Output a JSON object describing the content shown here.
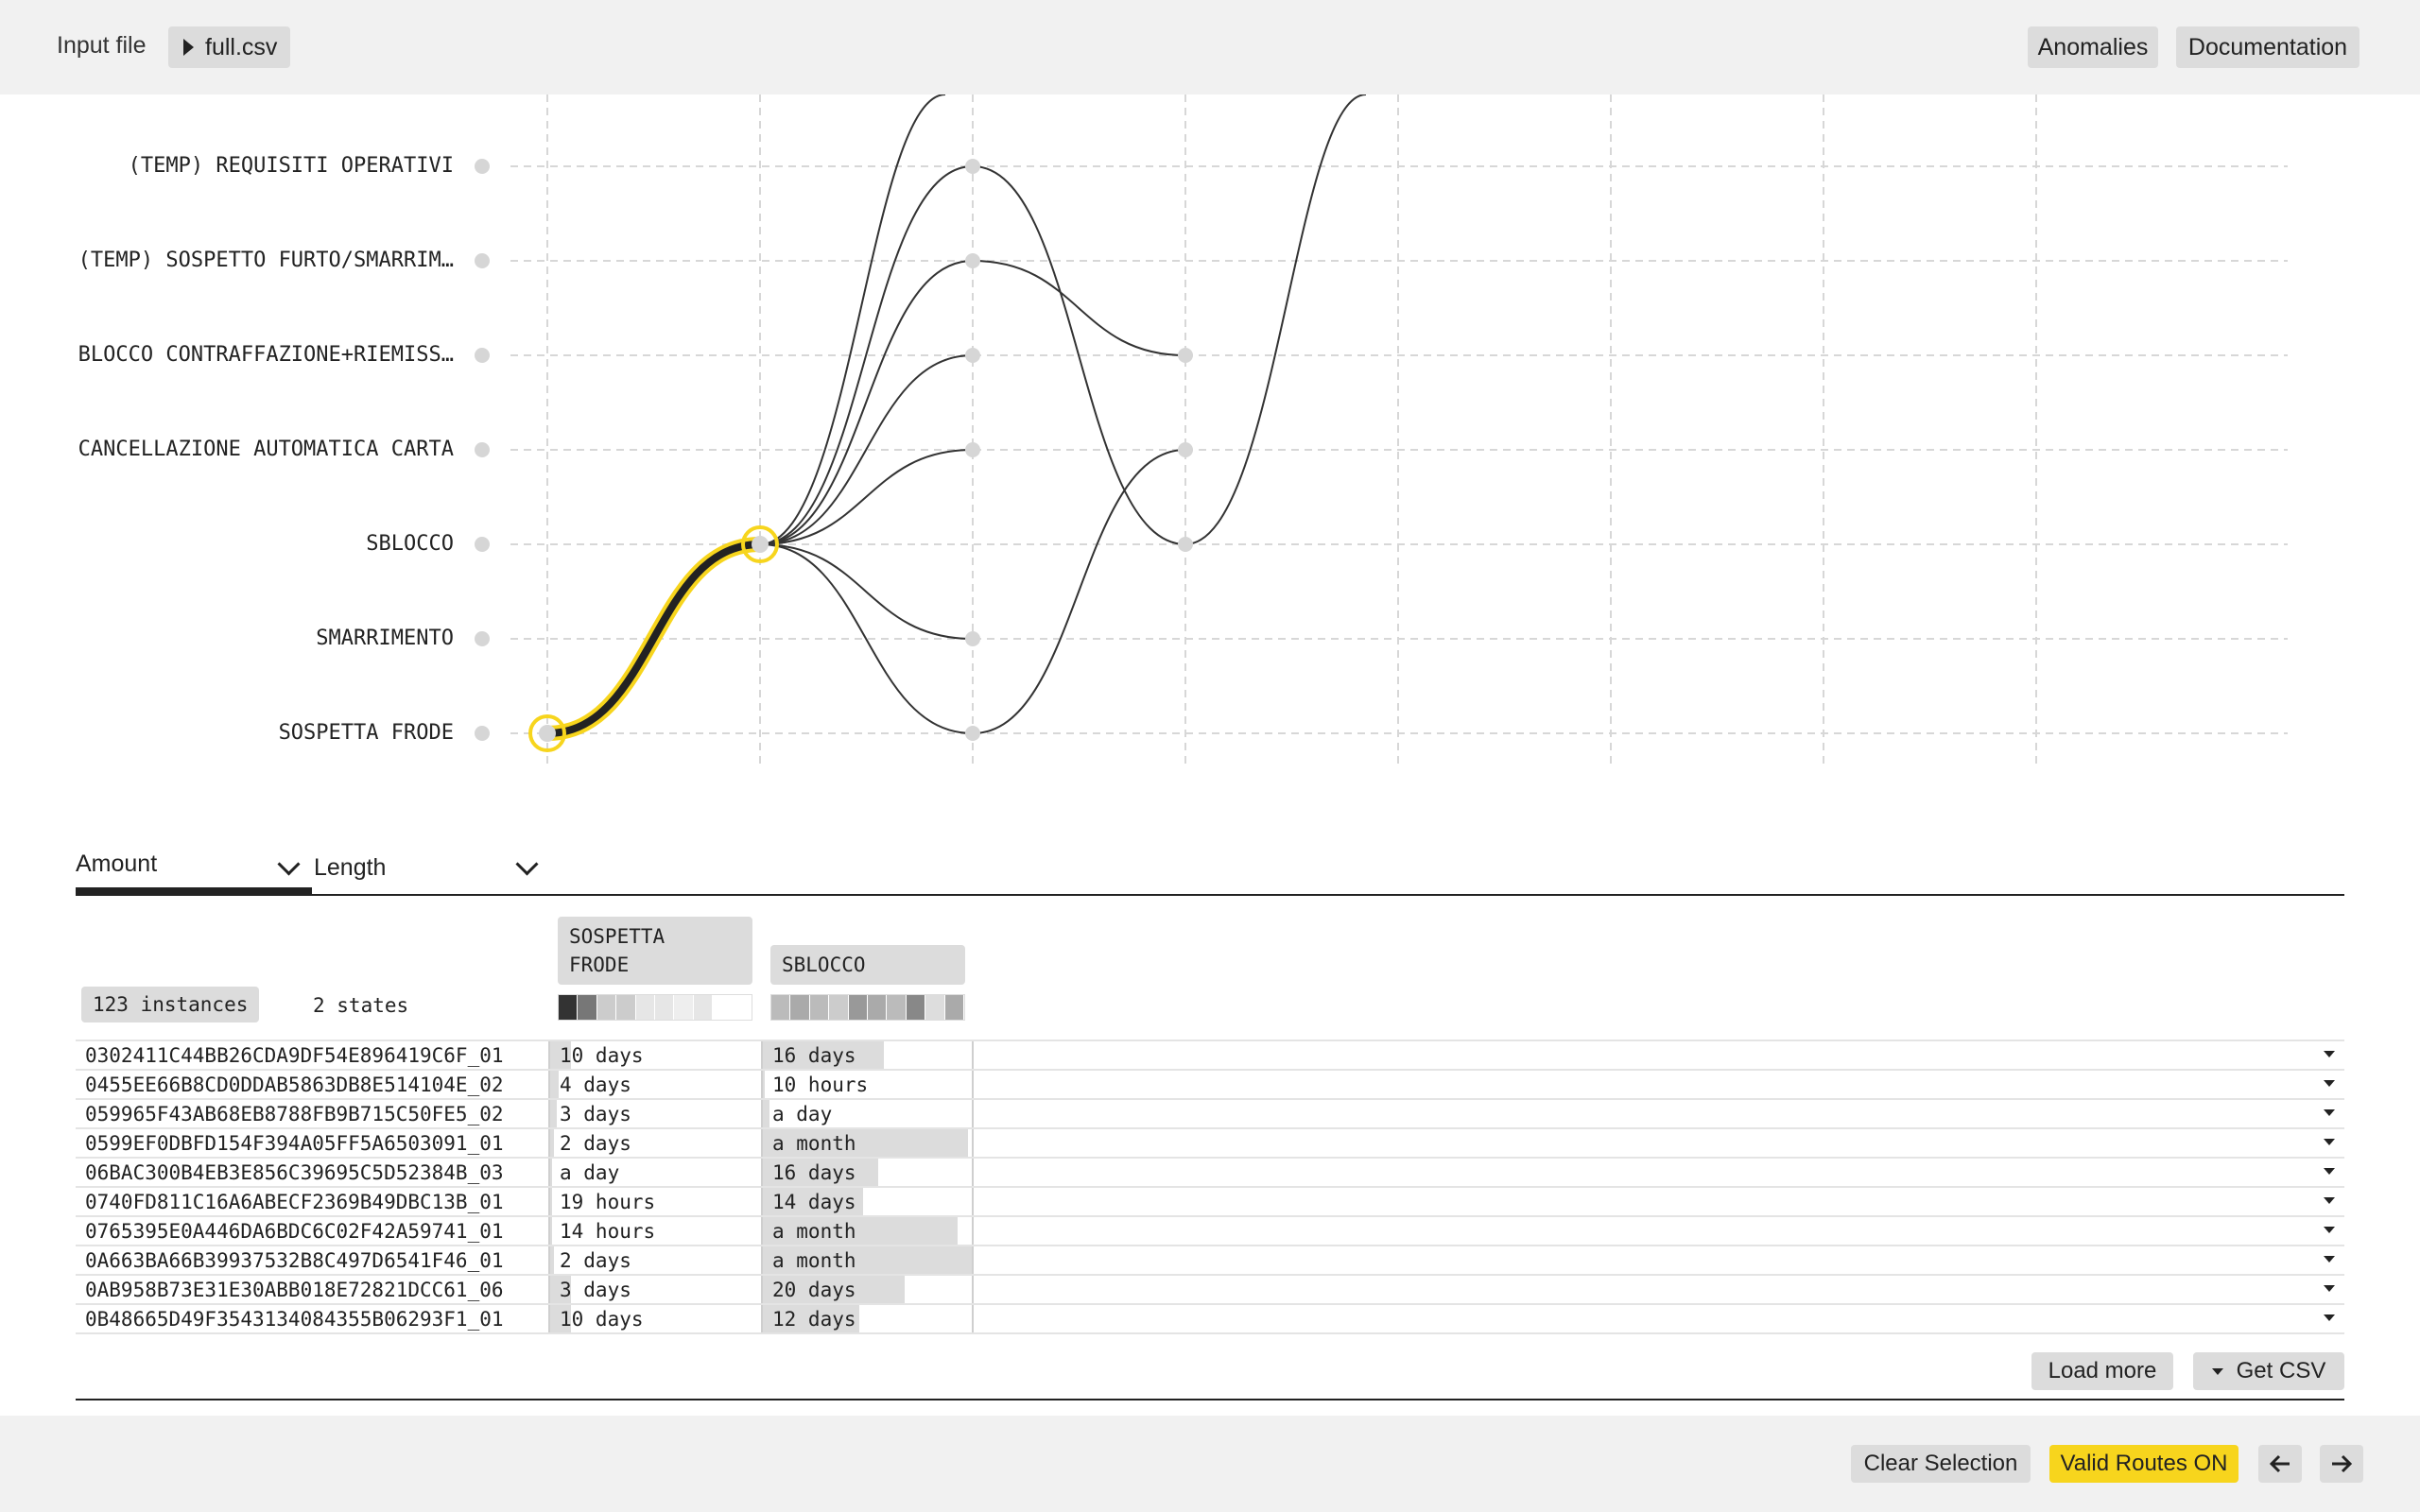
{
  "topbar": {
    "input_label": "Input file",
    "file_name": "full.csv",
    "anomalies_label": "Anomalies",
    "documentation_label": "Documentation"
  },
  "graph": {
    "states": [
      "(TEMP) REQUISITI OPERATIVI",
      "(TEMP) SOSPETTO FURTO/SMARRIM…",
      "BLOCCO CONTRAFFAZIONE+RIEMISS…",
      "CANCELLAZIONE AUTOMATICA CARTA",
      "SBLOCCO",
      "SMARRIMENTO",
      "SOSPETTA FRODE"
    ],
    "highlight_color": "#f7d51d",
    "selected_path": [
      "SOSPETTA FRODE",
      "SBLOCCO"
    ]
  },
  "tabs": [
    {
      "label": "Amount"
    },
    {
      "label": "Length"
    }
  ],
  "summary": {
    "instances": "123 instances",
    "states": "2 states"
  },
  "columns": [
    {
      "label": "SOSPETTA\nFRODE",
      "label_line1": "SOSPETTA",
      "label_line2": "FRODE"
    },
    {
      "label": "SBLOCCO",
      "label_line1": "SBLOCCO",
      "label_line2": ""
    }
  ],
  "rows": [
    {
      "id": "0302411C44BB26CDA9DF54E896419C6F_01",
      "c1": "10 days",
      "c1_frac": 0.1,
      "c2": "16 days",
      "c2_frac": 0.58
    },
    {
      "id": "0455EE66B8CD0DDAB5863DB8E514104E_02",
      "c1": "4 days",
      "c1_frac": 0.04,
      "c2": "10 hours",
      "c2_frac": 0.01
    },
    {
      "id": "059965F43AB68EB8788FB9B715C50FE5_02",
      "c1": "3 days",
      "c1_frac": 0.03,
      "c2": "a day",
      "c2_frac": 0.03
    },
    {
      "id": "0599EF0DBFD154F394A05FF5A6503091_01",
      "c1": "2 days",
      "c1_frac": 0.02,
      "c2": "a month",
      "c2_frac": 0.98
    },
    {
      "id": "06BAC300B4EB3E856C39695C5D52384B_03",
      "c1": "a day",
      "c1_frac": 0.01,
      "c2": "16 days",
      "c2_frac": 0.55
    },
    {
      "id": "0740FD811C16A6ABECF2369B49DBC13B_01",
      "c1": "19 hours",
      "c1_frac": 0.01,
      "c2": "14 days",
      "c2_frac": 0.48
    },
    {
      "id": "0765395E0A446DA6BDC6C02F42A59741_01",
      "c1": "14 hours",
      "c1_frac": 0.01,
      "c2": "a month",
      "c2_frac": 0.93
    },
    {
      "id": "0A663BA66B39937532B8C497D6541F46_01",
      "c1": "2 days",
      "c1_frac": 0.02,
      "c2": "a month",
      "c2_frac": 1.0
    },
    {
      "id": "0AB958B73E31E30ABB018E72821DCC61_06",
      "c1": "3 days",
      "c1_frac": 0.1,
      "c2": "20 days",
      "c2_frac": 0.68
    },
    {
      "id": "0B48665D49F3543134084355B06293F1_01",
      "c1": "10 days",
      "c1_frac": 0.1,
      "c2": "12 days",
      "c2_frac": 0.46
    }
  ],
  "actions": {
    "load_more": "Load more",
    "get_csv": "Get CSV",
    "clear_selection": "Clear Selection",
    "valid_routes": "Valid Routes ON",
    "valid_routes_color": "#f7d51d",
    "prev_icon": "arrow-left-icon",
    "next_icon": "arrow-right-icon"
  }
}
